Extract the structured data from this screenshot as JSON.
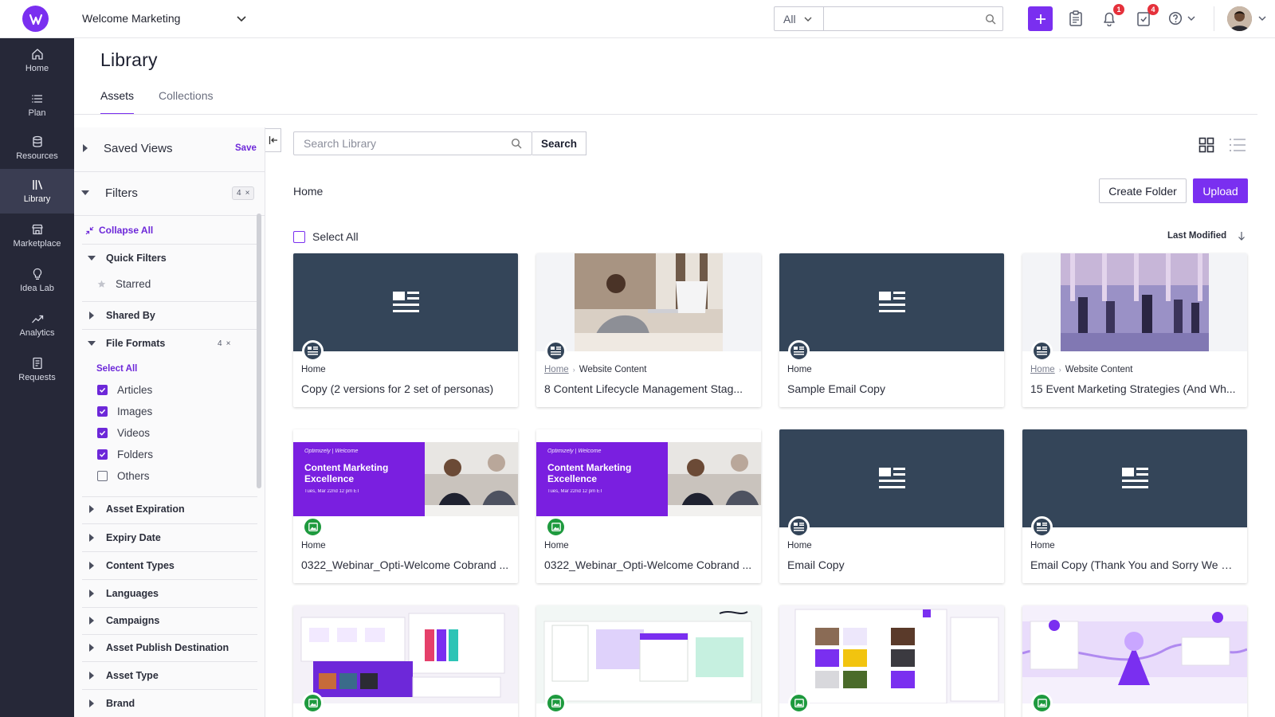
{
  "app": {
    "workspace": "Welcome Marketing",
    "top_search": {
      "scope": "All",
      "placeholder": ""
    },
    "notifications_count": "1",
    "tasks_count": "4"
  },
  "nav": [
    {
      "label": "Home",
      "icon": "home-icon"
    },
    {
      "label": "Plan",
      "icon": "list-icon"
    },
    {
      "label": "Resources",
      "icon": "database-icon"
    },
    {
      "label": "Library",
      "icon": "library-icon"
    },
    {
      "label": "Marketplace",
      "icon": "store-icon"
    },
    {
      "label": "Idea Lab",
      "icon": "lightbulb-icon"
    },
    {
      "label": "Analytics",
      "icon": "trend-icon"
    },
    {
      "label": "Requests",
      "icon": "document-icon"
    }
  ],
  "page": {
    "title": "Library",
    "tabs": [
      "Assets",
      "Collections"
    ],
    "active_tab": "Assets"
  },
  "filters": {
    "saved_views": "Saved Views",
    "save": "Save",
    "title": "Filters",
    "count": "4",
    "collapse_all": "Collapse All",
    "quick_filters": "Quick Filters",
    "starred": "Starred",
    "shared_by": "Shared By",
    "file_formats": "File Formats",
    "file_formats_count": "4",
    "select_all": "Select All",
    "formats": [
      {
        "label": "Articles",
        "checked": true
      },
      {
        "label": "Images",
        "checked": true
      },
      {
        "label": "Videos",
        "checked": true
      },
      {
        "label": "Folders",
        "checked": true
      },
      {
        "label": "Others",
        "checked": false
      }
    ],
    "sections": [
      "Asset Expiration",
      "Expiry Date",
      "Content Types",
      "Languages",
      "Campaigns",
      "Asset Publish Destination",
      "Asset Type",
      "Brand"
    ]
  },
  "library": {
    "search_placeholder": "Search Library",
    "search_button": "Search",
    "breadcrumb": "Home",
    "create_folder": "Create Folder",
    "upload": "Upload",
    "select_all": "Select All",
    "sort_label": "Last Modified"
  },
  "cards": [
    {
      "path": "Home",
      "subpath": "",
      "title": "Copy (2 versions for 2 set of personas)",
      "type": "article"
    },
    {
      "path": "Home",
      "subpath": "Website Content",
      "title": "8 Content Lifecycle Management Stag...",
      "type": "article"
    },
    {
      "path": "Home",
      "subpath": "",
      "title": "Sample Email Copy",
      "type": "article"
    },
    {
      "path": "Home",
      "subpath": "Website Content",
      "title": "15 Event Marketing Strategies (And Wh...",
      "type": "article"
    },
    {
      "path": "Home",
      "subpath": "",
      "title": "0322_Webinar_Opti-Welcome Cobrand ...",
      "type": "image"
    },
    {
      "path": "Home",
      "subpath": "",
      "title": "0322_Webinar_Opti-Welcome Cobrand ...",
      "type": "image"
    },
    {
      "path": "Home",
      "subpath": "",
      "title": "Email Copy",
      "type": "article"
    },
    {
      "path": "Home",
      "subpath": "",
      "title": "Email Copy (Thank You and Sorry We M...",
      "type": "article"
    },
    {
      "path": "",
      "subpath": "",
      "title": "",
      "type": "image"
    },
    {
      "path": "",
      "subpath": "",
      "title": "",
      "type": "image"
    },
    {
      "path": "",
      "subpath": "",
      "title": "",
      "type": "image"
    },
    {
      "path": "",
      "subpath": "",
      "title": "",
      "type": "image"
    }
  ],
  "webinar_thumb": {
    "brand": "Optimizely | Welcome",
    "title": "Content Marketing Excellence",
    "date": "Tues, Mar 22nd 12 pm ET"
  },
  "colors": {
    "accent": "#7a2ff0",
    "nav_bg": "#262838",
    "thumb_dark": "#344559",
    "image_badge": "#1e9a3e"
  }
}
